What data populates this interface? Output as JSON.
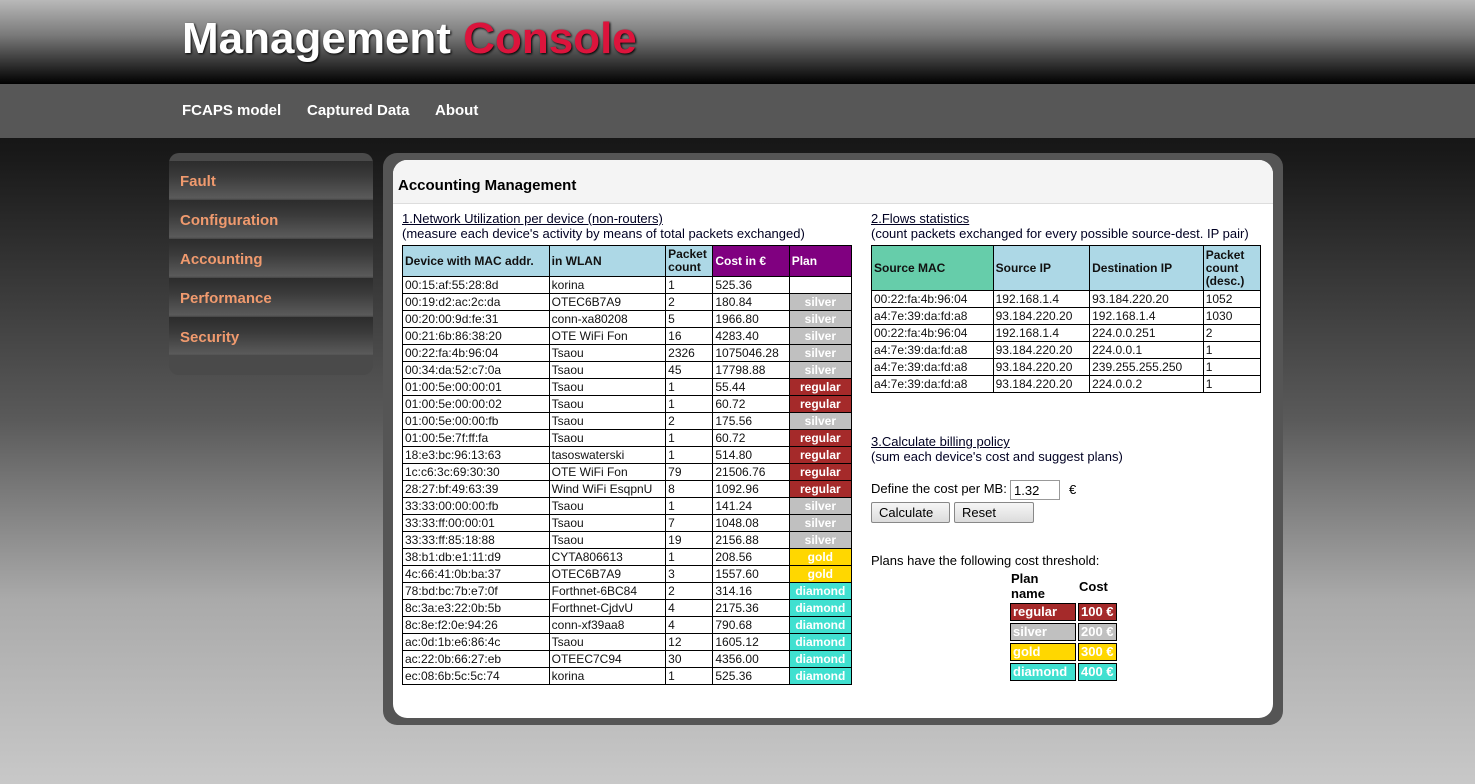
{
  "header": {
    "title_main": "Management",
    "title_accent": "Console"
  },
  "topnav": {
    "items": [
      "FCAPS model",
      "Captured Data",
      "About"
    ]
  },
  "sidebar": {
    "items": [
      "Fault",
      "Configuration",
      "Accounting",
      "Performance",
      "Security"
    ]
  },
  "page": {
    "title": "Accounting Management"
  },
  "colors": {
    "accent": "#dc143c",
    "sidebar_text": "#f09a6e",
    "regular": "#a52a2a",
    "silver": "#c0c0c0",
    "gold": "#ffd700",
    "diamond": "#40e0d0",
    "header_bg": "#add8e6",
    "cost_header": "#800080",
    "source_mac_header": "#66cdaa"
  },
  "utilization": {
    "title": "1.Network Utilization per device (non-routers)",
    "desc": "(measure each device's activity by means of total packets exchanged)",
    "headers": [
      "Device with MAC addr.",
      "in WLAN",
      "Packet count",
      "Cost in €",
      "Plan"
    ],
    "rows": [
      [
        "00:15:af:55:28:8d",
        "korina",
        "1",
        "525.36",
        ""
      ],
      [
        "00:19:d2:ac:2c:da",
        "OTEC6B7A9",
        "2",
        "180.84",
        "silver"
      ],
      [
        "00:20:00:9d:fe:31",
        "conn-xa80208",
        "5",
        "1966.80",
        "silver"
      ],
      [
        "00:21:6b:86:38:20",
        "OTE WiFi Fon",
        "16",
        "4283.40",
        "silver"
      ],
      [
        "00:22:fa:4b:96:04",
        "Tsaou",
        "2326",
        "1075046.28",
        "silver"
      ],
      [
        "00:34:da:52:c7:0a",
        "Tsaou",
        "45",
        "17798.88",
        "silver"
      ],
      [
        "01:00:5e:00:00:01",
        "Tsaou",
        "1",
        "55.44",
        "regular"
      ],
      [
        "01:00:5e:00:00:02",
        "Tsaou",
        "1",
        "60.72",
        "regular"
      ],
      [
        "01:00:5e:00:00:fb",
        "Tsaou",
        "2",
        "175.56",
        "silver"
      ],
      [
        "01:00:5e:7f:ff:fa",
        "Tsaou",
        "1",
        "60.72",
        "regular"
      ],
      [
        "18:e3:bc:96:13:63",
        "tasoswaterski",
        "1",
        "514.80",
        "regular"
      ],
      [
        "1c:c6:3c:69:30:30",
        "OTE WiFi Fon",
        "79",
        "21506.76",
        "regular"
      ],
      [
        "28:27:bf:49:63:39",
        "Wind WiFi EsqpnU",
        "8",
        "1092.96",
        "regular"
      ],
      [
        "33:33:00:00:00:fb",
        "Tsaou",
        "1",
        "141.24",
        "silver"
      ],
      [
        "33:33:ff:00:00:01",
        "Tsaou",
        "7",
        "1048.08",
        "silver"
      ],
      [
        "33:33:ff:85:18:88",
        "Tsaou",
        "19",
        "2156.88",
        "silver"
      ],
      [
        "38:b1:db:e1:11:d9",
        "CYTA806613",
        "1",
        "208.56",
        "gold"
      ],
      [
        "4c:66:41:0b:ba:37",
        "OTEC6B7A9",
        "3",
        "1557.60",
        "gold"
      ],
      [
        "78:bd:bc:7b:e7:0f",
        "Forthnet-6BC84",
        "2",
        "314.16",
        "diamond"
      ],
      [
        "8c:3a:e3:22:0b:5b",
        "Forthnet-CjdvU",
        "4",
        "2175.36",
        "diamond"
      ],
      [
        "8c:8e:f2:0e:94:26",
        "conn-xf39aa8",
        "4",
        "790.68",
        "diamond"
      ],
      [
        "ac:0d:1b:e6:86:4c",
        "Tsaou",
        "12",
        "1605.12",
        "diamond"
      ],
      [
        "ac:22:0b:66:27:eb",
        "OTEEC7C94",
        "30",
        "4356.00",
        "diamond"
      ],
      [
        "ec:08:6b:5c:5c:74",
        "korina",
        "1",
        "525.36",
        "diamond"
      ]
    ]
  },
  "flows": {
    "title": "2.Flows statistics",
    "desc": "(count packets exchanged for every possible source-dest. IP pair)",
    "headers": [
      "Source MAC",
      "Source IP",
      "Destination IP",
      "Packet count (desc.)"
    ],
    "rows": [
      [
        "00:22:fa:4b:96:04",
        "192.168.1.4",
        "93.184.220.20",
        "1052"
      ],
      [
        "a4:7e:39:da:fd:a8",
        "93.184.220.20",
        "192.168.1.4",
        "1030"
      ],
      [
        "00:22:fa:4b:96:04",
        "192.168.1.4",
        "224.0.0.251",
        "2"
      ],
      [
        "a4:7e:39:da:fd:a8",
        "93.184.220.20",
        "224.0.0.1",
        "1"
      ],
      [
        "a4:7e:39:da:fd:a8",
        "93.184.220.20",
        "239.255.255.250",
        "1"
      ],
      [
        "a4:7e:39:da:fd:a8",
        "93.184.220.20",
        "224.0.0.2",
        "1"
      ]
    ]
  },
  "billing": {
    "title": "3.Calculate billing policy",
    "desc": "(sum each device's cost and suggest plans)",
    "cost_label": "Define the cost per MB:",
    "cost_value": "1.32",
    "cost_unit": "€",
    "calculate_label": "Calculate",
    "reset_label": "Reset",
    "threshold_note": "Plans have the following cost threshold:",
    "plan_headers": [
      "Plan name",
      "Cost"
    ],
    "plans": [
      [
        "regular",
        "100 €"
      ],
      [
        "silver",
        "200 €"
      ],
      [
        "gold",
        "300 €"
      ],
      [
        "diamond",
        "400 €"
      ]
    ]
  }
}
